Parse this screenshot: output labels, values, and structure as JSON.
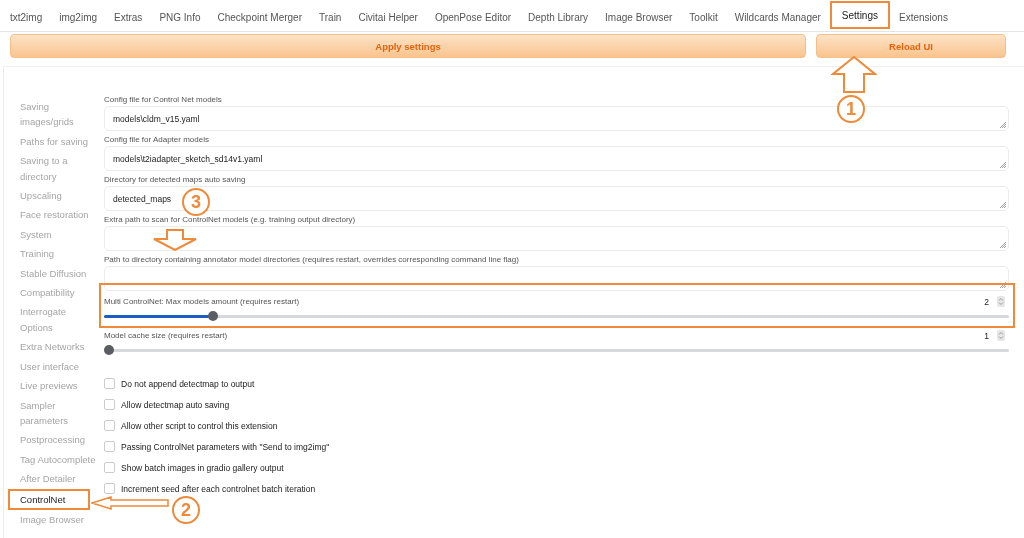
{
  "tabs": [
    {
      "label": "txt2img",
      "selected": false
    },
    {
      "label": "img2img",
      "selected": false
    },
    {
      "label": "Extras",
      "selected": false
    },
    {
      "label": "PNG Info",
      "selected": false
    },
    {
      "label": "Checkpoint Merger",
      "selected": false
    },
    {
      "label": "Train",
      "selected": false
    },
    {
      "label": "Civitai Helper",
      "selected": false
    },
    {
      "label": "OpenPose Editor",
      "selected": false
    },
    {
      "label": "Depth Library",
      "selected": false
    },
    {
      "label": "Image Browser",
      "selected": false
    },
    {
      "label": "Toolkit",
      "selected": false
    },
    {
      "label": "Wildcards Manager",
      "selected": false
    },
    {
      "label": "Settings",
      "selected": true
    },
    {
      "label": "Extensions",
      "selected": false
    }
  ],
  "buttons": [
    "Apply settings",
    "Reload UI"
  ],
  "sidebar": {
    "items": [
      {
        "label": "Saving images/grids",
        "selected": false
      },
      {
        "label": "Paths for saving",
        "selected": false
      },
      {
        "label": "Saving to a directory",
        "selected": false
      },
      {
        "label": "Upscaling",
        "selected": false
      },
      {
        "label": "Face restoration",
        "selected": false
      },
      {
        "label": "System",
        "selected": false
      },
      {
        "label": "Training",
        "selected": false
      },
      {
        "label": "Stable Diffusion",
        "selected": false
      },
      {
        "label": "Compatibility",
        "selected": false
      },
      {
        "label": "Interrogate Options",
        "selected": false
      },
      {
        "label": "Extra Networks",
        "selected": false
      },
      {
        "label": "User interface",
        "selected": false
      },
      {
        "label": "Live previews",
        "selected": false
      },
      {
        "label": "Sampler parameters",
        "selected": false
      },
      {
        "label": "Postprocessing",
        "selected": false
      },
      {
        "label": "Tag Autocomplete",
        "selected": false
      },
      {
        "label": "After Detailer",
        "selected": false
      },
      {
        "label": "ControlNet",
        "selected": true
      },
      {
        "label": "Image Browser",
        "selected": false
      }
    ]
  },
  "settings": [
    {
      "kind": "text",
      "label": "Config file for Control Net models",
      "value": "models\\cldm_v15.yaml"
    },
    {
      "kind": "text",
      "label": "Config file for Adapter models",
      "value": "models\\t2iadapter_sketch_sd14v1.yaml"
    },
    {
      "kind": "text",
      "label": "Directory for detected maps auto saving",
      "value": "detected_maps"
    },
    {
      "kind": "text",
      "label": "Extra path to scan for ControlNet models (e.g. training output directory)"
    },
    {
      "kind": "text",
      "label": "Path to directory containing annotator model directories (requires restart, overrides corresponding command line flag)"
    },
    {
      "kind": "slider",
      "label": "Multi ControlNet: Max models amount (requires restart)",
      "value": "2",
      "level": 0.116
    },
    {
      "kind": "slider",
      "label": "Model cache size (requires restart)",
      "value": "1",
      "level": 0
    },
    {
      "kind": "checkbox",
      "label": "Do not append detectmap to output",
      "checked": false
    },
    {
      "kind": "checkbox",
      "label": "Allow detectmap auto saving",
      "checked": false
    },
    {
      "kind": "checkbox",
      "label": "Allow other script to control this extension",
      "checked": false
    },
    {
      "kind": "checkbox",
      "label": "Passing ControlNet parameters with \"Send to img2img\"",
      "checked": false
    },
    {
      "kind": "checkbox",
      "label": "Show batch images in gradio gallery output",
      "checked": false
    },
    {
      "kind": "checkbox",
      "label": "Increment seed after each controlnet batch iteration",
      "checked": false
    }
  ],
  "annotations": {
    "markers": [
      "1",
      "2",
      "3"
    ]
  }
}
